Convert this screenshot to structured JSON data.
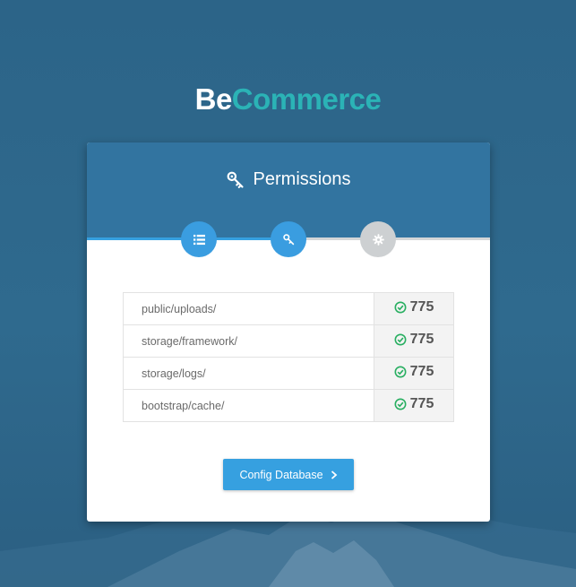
{
  "brand": {
    "part1": "Be",
    "part2": "Commerce"
  },
  "card": {
    "title": "Permissions",
    "title_icon": "key-icon"
  },
  "steps": [
    {
      "icon": "list-icon",
      "state": "active"
    },
    {
      "icon": "key-icon",
      "state": "active"
    },
    {
      "icon": "gear-icon",
      "state": "inactive"
    }
  ],
  "permissions": [
    {
      "path": "public/uploads/",
      "value": "775",
      "status": "ok"
    },
    {
      "path": "storage/framework/",
      "value": "775",
      "status": "ok"
    },
    {
      "path": "storage/logs/",
      "value": "775",
      "status": "ok"
    },
    {
      "path": "bootstrap/cache/",
      "value": "775",
      "status": "ok"
    }
  ],
  "button": {
    "label": "Config Database",
    "icon": "chevron-right-icon"
  },
  "colors": {
    "background": "#2f6a8e",
    "header": "#3274a0",
    "accent": "#36a0e0",
    "brand_teal": "#2bb3b6",
    "ok_green": "#27ae60"
  }
}
